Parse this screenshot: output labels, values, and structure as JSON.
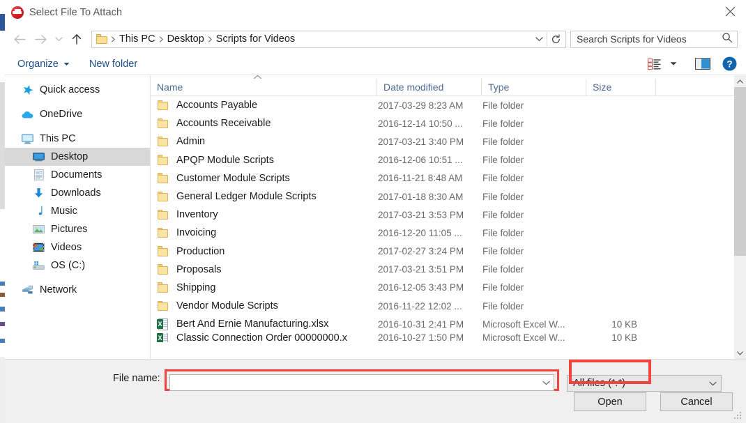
{
  "window": {
    "title": "Select File To Attach",
    "app_icon": "app-logo-icon",
    "close_label": "×"
  },
  "nav": {
    "back_icon": "back-arrow-icon",
    "forward_icon": "forward-arrow-icon",
    "recent_icon": "recent-locations-chevron-icon",
    "up_icon": "up-arrow-icon",
    "refresh_icon": "refresh-icon",
    "address_chevron_icon": "address-dropdown-chevron-icon",
    "breadcrumbs": [
      "This PC",
      "Desktop",
      "Scripts for Videos"
    ],
    "separator": "›"
  },
  "search": {
    "placeholder": "Search Scripts for Videos",
    "value": "",
    "icon": "search-icon"
  },
  "toolbar": {
    "organize_label": "Organize",
    "new_folder_label": "New folder",
    "view_icon": "view-layout-icon",
    "view_caret_icon": "chevron-down-icon",
    "preview_pane_icon": "preview-pane-icon",
    "help_icon": "help-icon",
    "help_glyph": "?"
  },
  "sidebar": {
    "items": [
      {
        "label": "Quick access",
        "icon": "star-icon",
        "level": 0,
        "selected": false
      },
      {
        "label": "OneDrive",
        "icon": "cloud-icon",
        "level": 0,
        "selected": false
      },
      {
        "label": "This PC",
        "icon": "monitor-icon",
        "level": 0,
        "selected": false
      },
      {
        "label": "Desktop",
        "icon": "desktop-icon",
        "level": 1,
        "selected": true
      },
      {
        "label": "Documents",
        "icon": "documents-icon",
        "level": 1,
        "selected": false
      },
      {
        "label": "Downloads",
        "icon": "download-arrow-icon",
        "level": 1,
        "selected": false
      },
      {
        "label": "Music",
        "icon": "music-note-icon",
        "level": 1,
        "selected": false
      },
      {
        "label": "Pictures",
        "icon": "picture-icon",
        "level": 1,
        "selected": false
      },
      {
        "label": "Videos",
        "icon": "videos-icon",
        "level": 1,
        "selected": false
      },
      {
        "label": "OS (C:)",
        "icon": "drive-icon",
        "level": 1,
        "selected": false
      },
      {
        "label": "Network",
        "icon": "network-icon",
        "level": 0,
        "selected": false
      }
    ]
  },
  "filelist": {
    "columns": [
      "Name",
      "Date modified",
      "Type",
      "Size"
    ],
    "sort_column": "Name",
    "sort_direction": "ascending",
    "rows": [
      {
        "name": "Accounts Payable",
        "date": "2017-03-29 8:23 AM",
        "type": "File folder",
        "size": "",
        "icon": "folder-icon"
      },
      {
        "name": "Accounts Receivable",
        "date": "2016-12-14 10:50 ...",
        "type": "File folder",
        "size": "",
        "icon": "folder-icon"
      },
      {
        "name": "Admin",
        "date": "2017-03-21 3:40 PM",
        "type": "File folder",
        "size": "",
        "icon": "folder-icon"
      },
      {
        "name": "APQP Module Scripts",
        "date": "2016-12-06 10:51 ...",
        "type": "File folder",
        "size": "",
        "icon": "folder-icon"
      },
      {
        "name": "Customer Module Scripts",
        "date": "2016-11-21 8:48 AM",
        "type": "File folder",
        "size": "",
        "icon": "folder-icon"
      },
      {
        "name": "General Ledger Module Scripts",
        "date": "2017-01-18 8:30 AM",
        "type": "File folder",
        "size": "",
        "icon": "folder-icon"
      },
      {
        "name": "Inventory",
        "date": "2017-03-21 3:53 PM",
        "type": "File folder",
        "size": "",
        "icon": "folder-icon"
      },
      {
        "name": "Invoicing",
        "date": "2016-12-20 11:05 ...",
        "type": "File folder",
        "size": "",
        "icon": "folder-icon"
      },
      {
        "name": "Production",
        "date": "2017-02-27 3:24 PM",
        "type": "File folder",
        "size": "",
        "icon": "folder-icon"
      },
      {
        "name": "Proposals",
        "date": "2017-03-21 3:51 PM",
        "type": "File folder",
        "size": "",
        "icon": "folder-icon"
      },
      {
        "name": "Shipping",
        "date": "2016-12-05 3:43 PM",
        "type": "File folder",
        "size": "",
        "icon": "folder-icon"
      },
      {
        "name": "Vendor Module Scripts",
        "date": "2016-11-22 12:02 ...",
        "type": "File folder",
        "size": "",
        "icon": "folder-icon"
      },
      {
        "name": "Bert And Ernie Manufacturing.xlsx",
        "date": "2016-10-31 2:41 PM",
        "type": "Microsoft Excel W...",
        "size": "10 KB",
        "icon": "excel-file-icon"
      },
      {
        "name": "Classic Connection Order 00000000.x",
        "date": "2016-10-27 1:50 PM",
        "type": "Microsoft Excel W...",
        "size": "10 KB",
        "icon": "excel-file-icon"
      }
    ],
    "scrollbar": {
      "up_icon": "scroll-up-icon",
      "down_icon": "scroll-down-icon",
      "thumb_position_percent": 0,
      "thumb_size_percent": 65
    }
  },
  "bottom": {
    "filename_label": "File name:",
    "filename_value": "",
    "filename_placeholder": "",
    "filename_chevron_icon": "chevron-down-icon",
    "filetype_value": "All files (*.*)",
    "filetype_chevron_icon": "chevron-down-icon",
    "open_label": "Open",
    "cancel_label": "Cancel",
    "resize_grip_icon": "resize-grip-icon"
  },
  "annotations": {
    "highlight_color": "#f4433c",
    "targets": [
      "filename-input",
      "open-button"
    ]
  }
}
